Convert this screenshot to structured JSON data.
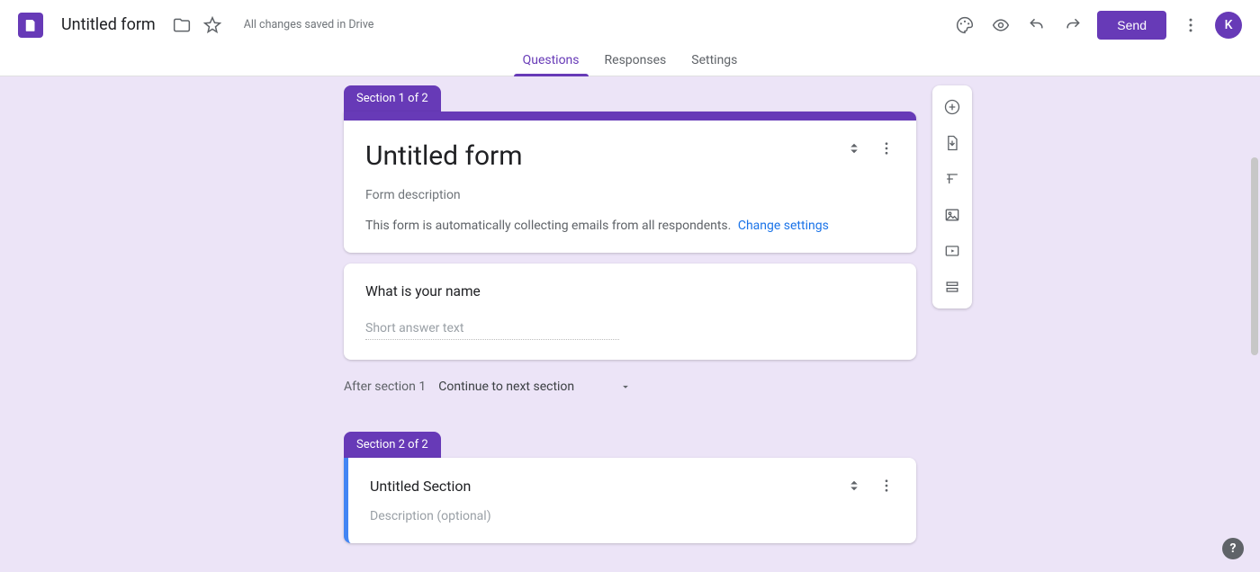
{
  "header": {
    "form_title": "Untitled form",
    "save_status": "All changes saved in Drive",
    "send_label": "Send",
    "avatar_initial": "K"
  },
  "tabs": {
    "questions": "Questions",
    "responses": "Responses",
    "settings": "Settings"
  },
  "section1": {
    "tab_label": "Section 1 of 2",
    "title": "Untitled form",
    "description": "Form description",
    "email_notice": "This form is automatically collecting emails from all respondents.",
    "change_settings": "Change settings"
  },
  "question1": {
    "text": "What is your name",
    "placeholder": "Short answer text"
  },
  "after_section": {
    "label": "After section 1",
    "selected": "Continue to next section"
  },
  "section2": {
    "tab_label": "Section 2 of 2",
    "title": "Untitled Section",
    "description": "Description (optional)"
  },
  "colors": {
    "primary": "#673ab7",
    "link": "#1a73e8",
    "accent_blue": "#4285f4"
  }
}
